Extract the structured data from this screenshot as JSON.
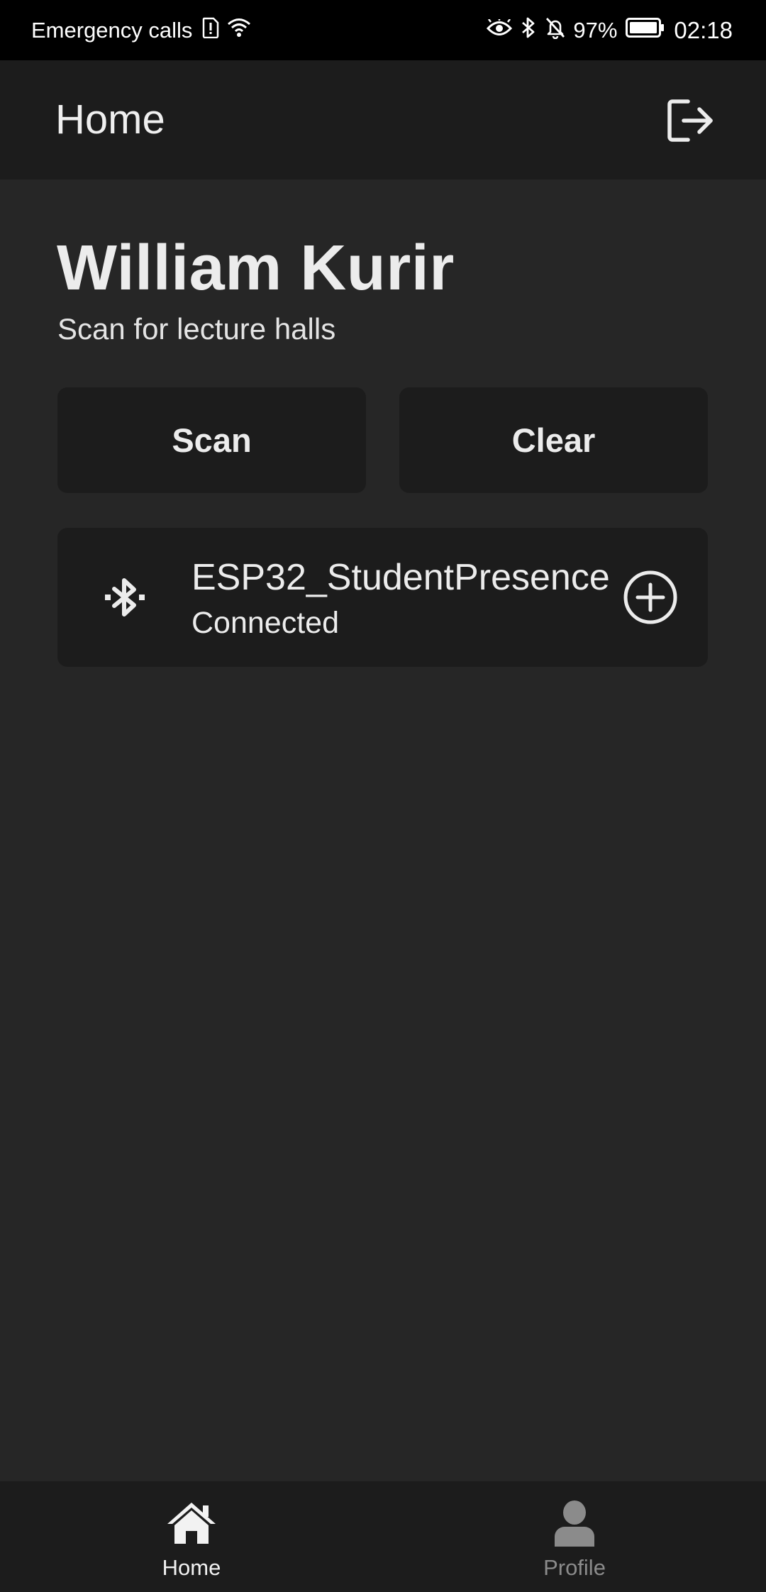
{
  "status_bar": {
    "carrier_text": "Emergency calls",
    "battery_percent": "97%",
    "time": "02:18",
    "icons": [
      "sim-alert-icon",
      "wifi-icon",
      "eye-icon",
      "bluetooth-icon",
      "bell-off-icon",
      "battery-icon"
    ]
  },
  "app_bar": {
    "title": "Home",
    "action_icon": "logout-icon"
  },
  "main": {
    "user_name": "William Kurir",
    "subtitle": "Scan for lecture halls",
    "scan_label": "Scan",
    "clear_label": "Clear",
    "devices": [
      {
        "name": "ESP32_StudentPresence",
        "status": "Connected",
        "icon": "bluetooth-icon",
        "action_icon": "add-circle-icon"
      }
    ]
  },
  "bottom_nav": {
    "items": [
      {
        "label": "Home",
        "icon": "home-icon",
        "active": true
      },
      {
        "label": "Profile",
        "icon": "person-icon",
        "active": false
      }
    ]
  },
  "colors": {
    "background": "#262626",
    "surface": "#1c1c1c",
    "status_bar": "#000000",
    "text": "#ececec",
    "inactive": "#8b8b8b"
  }
}
